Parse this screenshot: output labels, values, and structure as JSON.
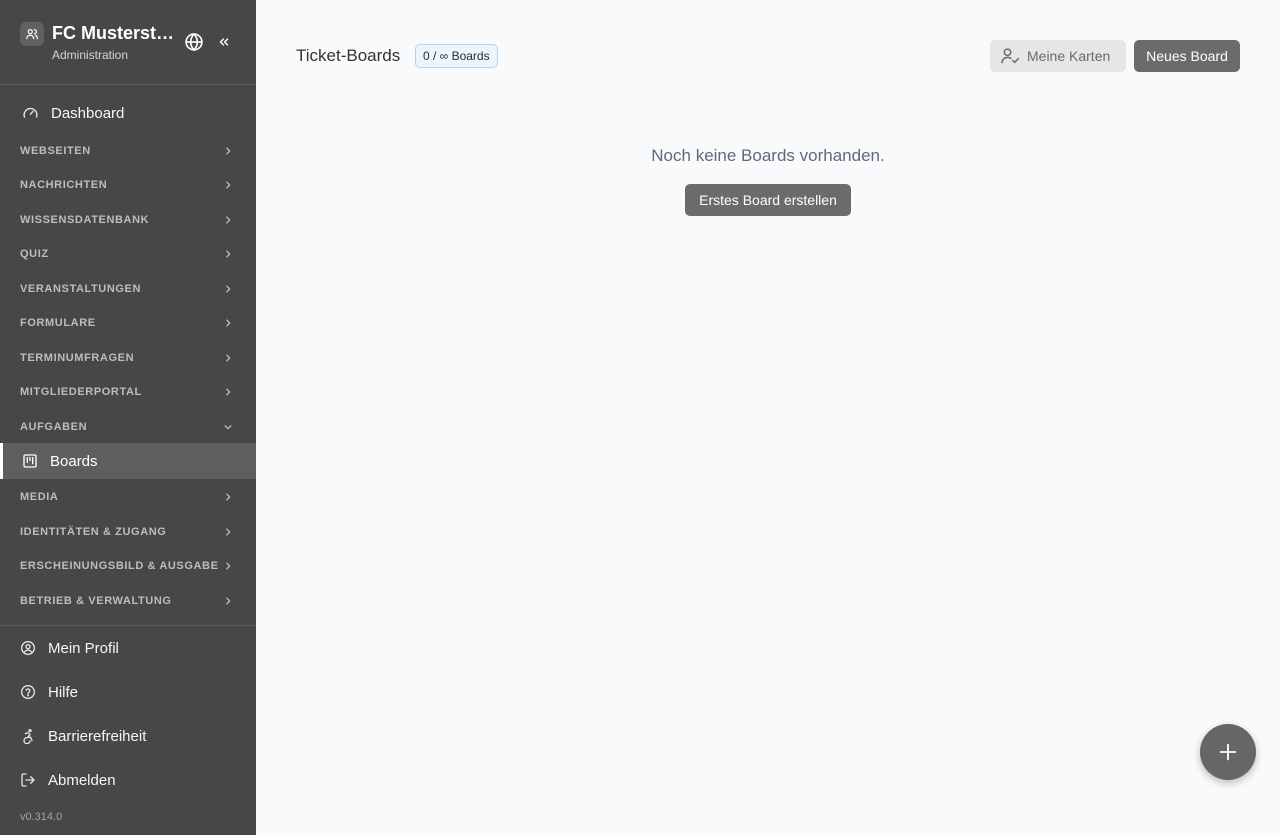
{
  "sidebar": {
    "org_name": "FC Musterst…",
    "org_subtitle": "Administration",
    "dashboard_label": "Dashboard",
    "sections": [
      {
        "label": "WEBSEITEN",
        "expanded": false
      },
      {
        "label": "NACHRICHTEN",
        "expanded": false
      },
      {
        "label": "WISSENSDATENBANK",
        "expanded": false
      },
      {
        "label": "QUIZ",
        "expanded": false
      },
      {
        "label": "VERANSTALTUNGEN",
        "expanded": false
      },
      {
        "label": "FORMULARE",
        "expanded": false
      },
      {
        "label": "TERMINUMFRAGEN",
        "expanded": false
      },
      {
        "label": "MITGLIEDERPORTAL",
        "expanded": false
      },
      {
        "label": "AUFGABEN",
        "expanded": true
      },
      {
        "label": "MEDIA",
        "expanded": false
      },
      {
        "label": "IDENTITÄTEN & ZUGANG",
        "expanded": false
      },
      {
        "label": "ERSCHEINUNGSBILD & AUSGABE",
        "expanded": false
      },
      {
        "label": "BETRIEB & VERWALTUNG",
        "expanded": false
      }
    ],
    "active_item": "Boards",
    "bottom": {
      "profile": "Mein Profil",
      "help": "Hilfe",
      "accessibility": "Barrierefreiheit",
      "logout": "Abmelden"
    },
    "version": "v0.314.0"
  },
  "main": {
    "title": "Ticket-Boards",
    "badge": "0 / ∞ Boards",
    "my_cards_label": "Meine Karten",
    "new_board_label": "Neues Board",
    "empty_message": "Noch keine Boards vorhanden.",
    "create_first_label": "Erstes Board erstellen"
  },
  "colors": {
    "sidebar_bg": "#474747",
    "active_item_bg": "#5e5e5e",
    "main_bg": "#f8fafc",
    "primary_button": "#6b6b6b"
  }
}
